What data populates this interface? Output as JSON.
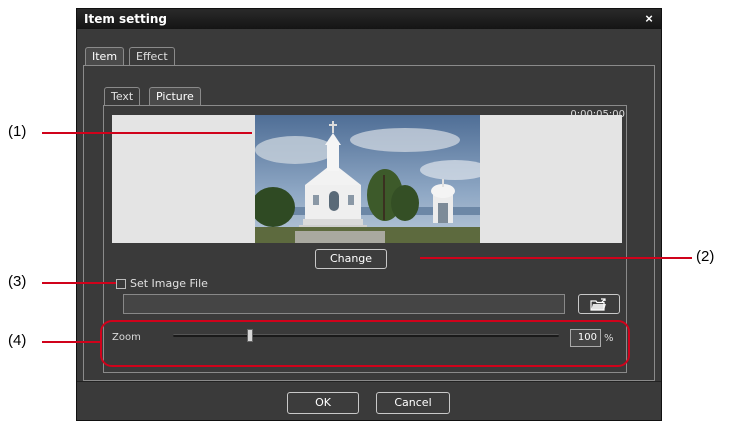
{
  "dialog": {
    "title": "Item setting",
    "close_glyph": "×",
    "tabs": [
      {
        "label": "Item",
        "active": true
      },
      {
        "label": "Effect",
        "active": false
      }
    ],
    "subtabs": [
      {
        "label": "Text",
        "active": false
      },
      {
        "label": "Picture",
        "active": true
      }
    ],
    "timecode": "0:00:05:00",
    "change_button": "Change",
    "set_image_label": "Set Image File",
    "set_image_checked": false,
    "file_path_value": "",
    "browse_icon": "folder-open-icon",
    "zoom": {
      "label": "Zoom",
      "value": "100",
      "unit": "%",
      "slider_fraction": 0.2
    },
    "ok_button": "OK",
    "cancel_button": "Cancel"
  },
  "annotations": {
    "callouts": [
      "(1)",
      "(2)",
      "(3)",
      "(4)"
    ],
    "color": "#d0021b"
  },
  "colors": {
    "dialog_bg": "#3a3a3a",
    "titlebar_bg": "#1a1a1a",
    "preview_bg": "#e4e4e4"
  }
}
